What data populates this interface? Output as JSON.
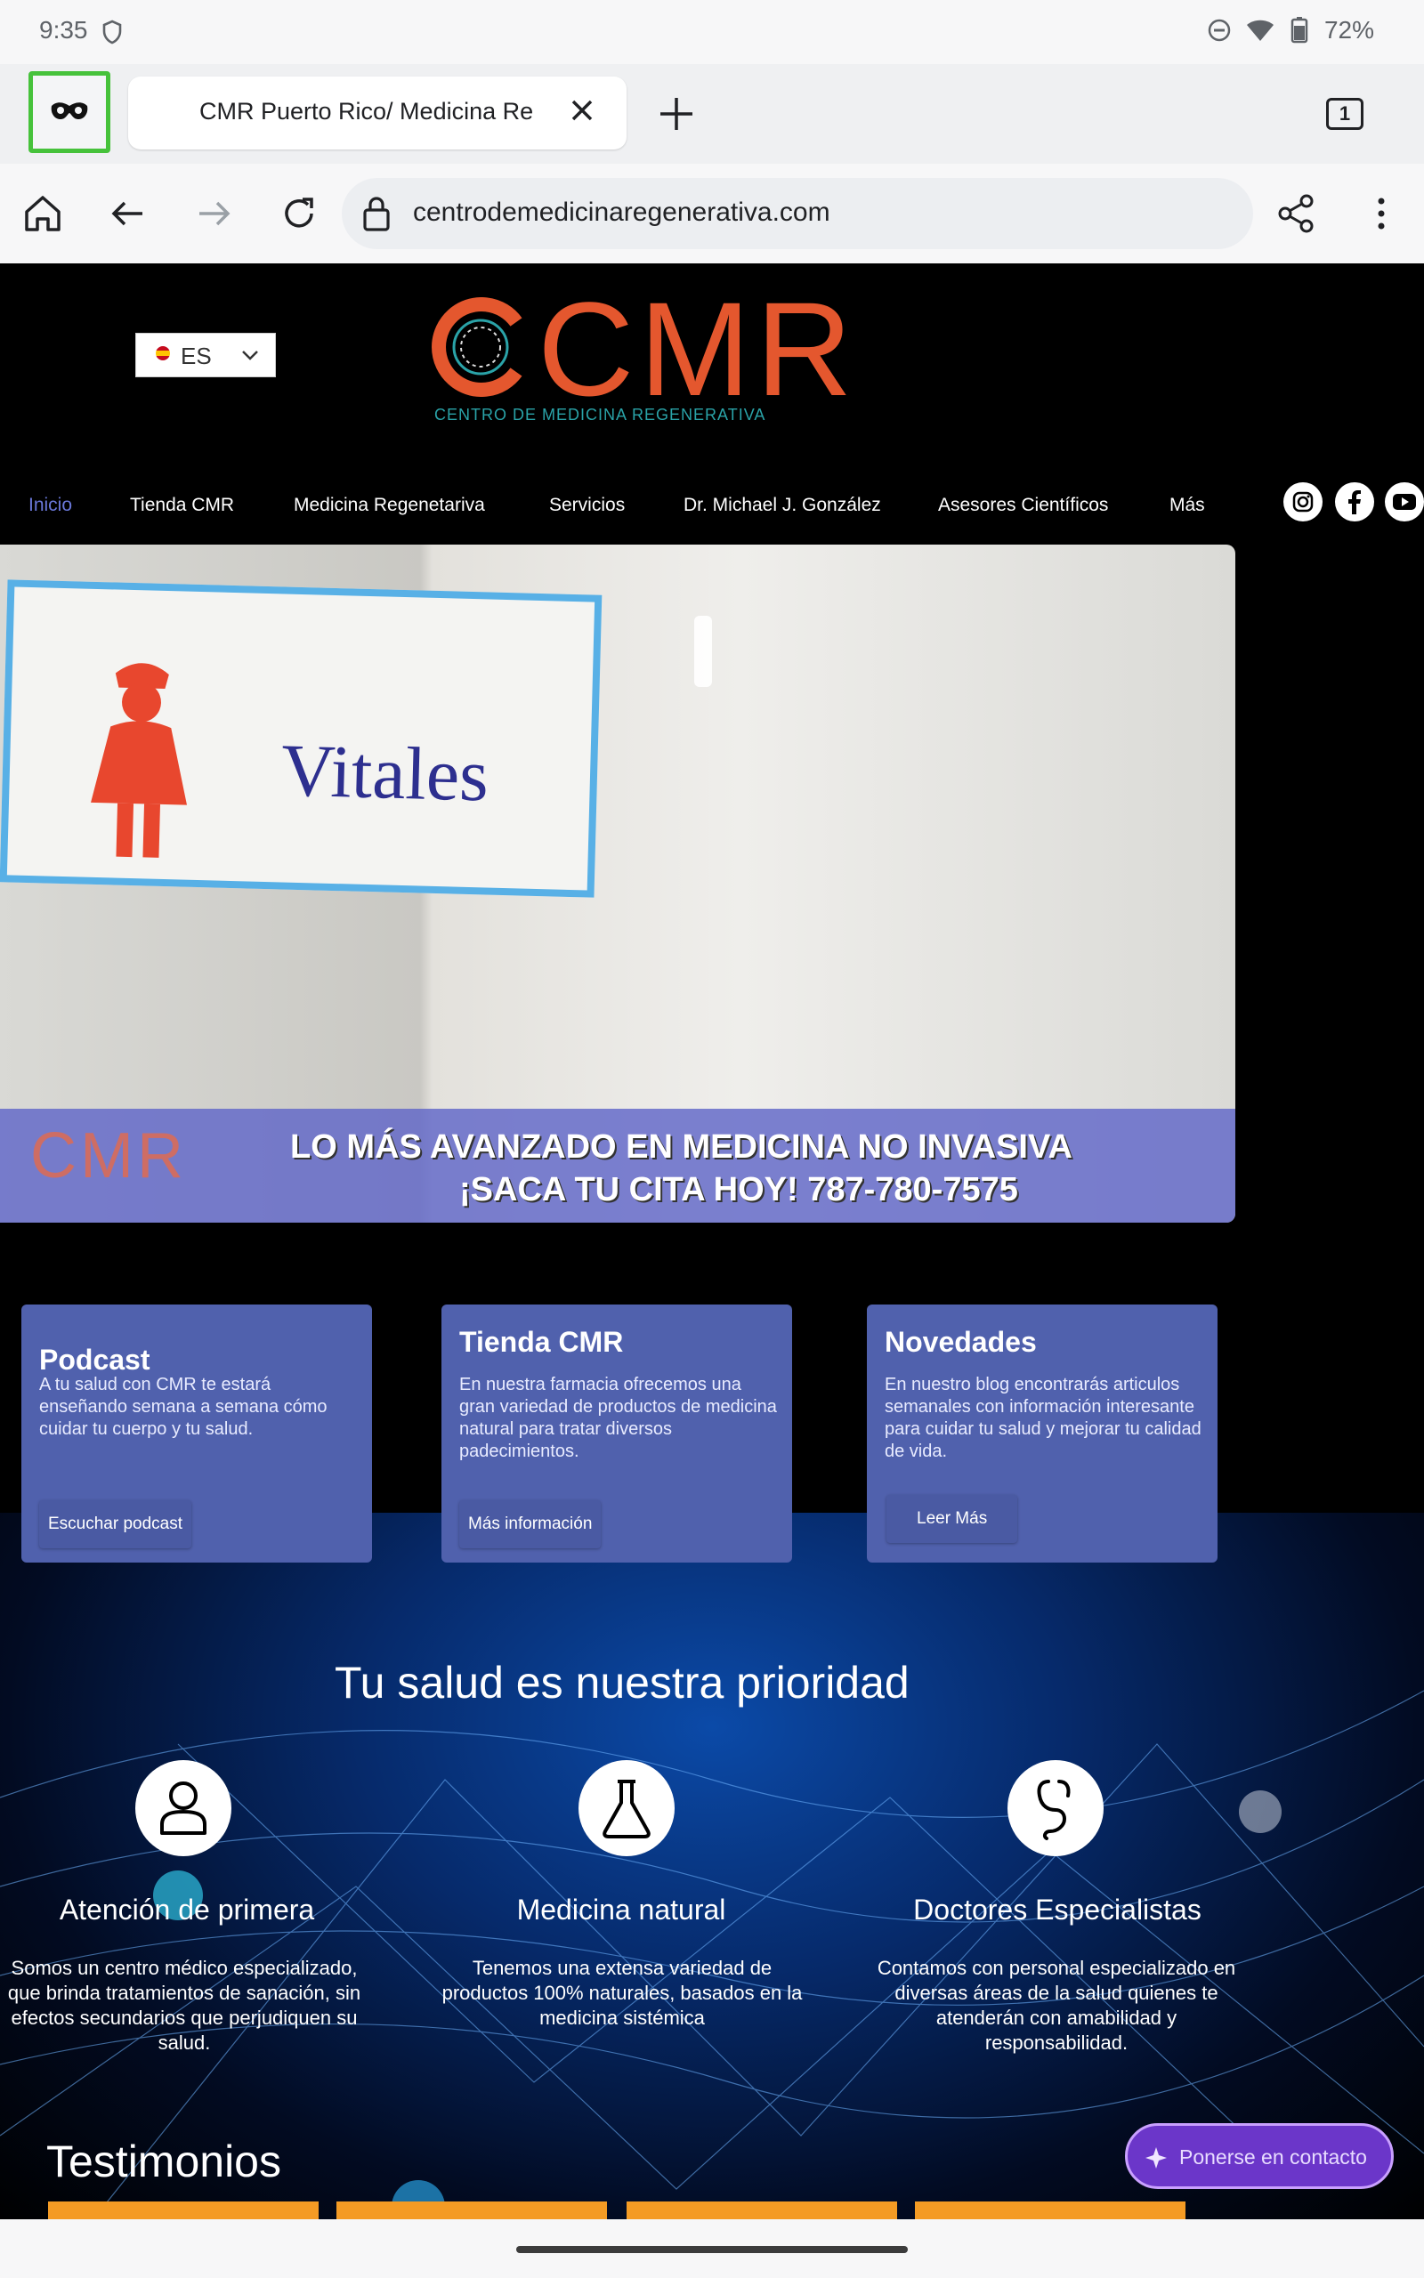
{
  "status_bar": {
    "time": "9:35",
    "battery": "72%"
  },
  "browser": {
    "tab_title": "CMR Puerto Rico/ Medicina Re",
    "tab_count": "1",
    "url": "centrodemedicinaregenerativa.com"
  },
  "site": {
    "language": "ES",
    "logo_main": "CMR",
    "logo_sub": "CENTRO DE MEDICINA REGENERATIVA",
    "nav": [
      "Inicio",
      "Tienda CMR",
      "Medicina Regenetariva",
      "Servicios",
      "Dr. Michael J. González",
      "Asesores Científicos",
      "Más"
    ],
    "hero": {
      "sign_text": "Vitales",
      "banner_logo": "CMR",
      "line1": "LO MÁS AVANZADO EN MEDICINA NO INVASIVA",
      "line2": "¡SACA TU CITA HOY!  787-780-7575"
    },
    "cards": [
      {
        "title": "Podcast",
        "text": "A tu salud con CMR te estará enseñando semana a semana cómo cuidar tu cuerpo y tu salud.",
        "button": "Escuchar podcast"
      },
      {
        "title": "Tienda CMR",
        "text": "En nuestra farmacia ofrecemos una gran variedad de productos de medicina natural para tratar diversos padecimientos.",
        "button": "Más información"
      },
      {
        "title": "Novedades",
        "text": "En nuestro blog encontrarás articulos semanales con información interesante para cuidar tu salud y mejorar tu calidad de vida.",
        "button": "Leer Más"
      }
    ],
    "priority_heading": "Tu salud es nuestra prioridad",
    "features": [
      {
        "title": "Atención de primera",
        "text": "Somos un centro médico especializado, que brinda tratamientos de sanación, sin efectos secundarios que perjudiquen su salud."
      },
      {
        "title": "Medicina natural",
        "text": "Tenemos una extensa variedad de productos 100% naturales, basados en la medicina sistémica"
      },
      {
        "title": "Doctores Especialistas",
        "text": "Contamos con personal especializado en diversas áreas de la salud quienes te atenderán con amabilidad y responsabilidad."
      }
    ],
    "testimonials_heading": "Testimonios",
    "contact_button": "Ponerse en contacto"
  }
}
